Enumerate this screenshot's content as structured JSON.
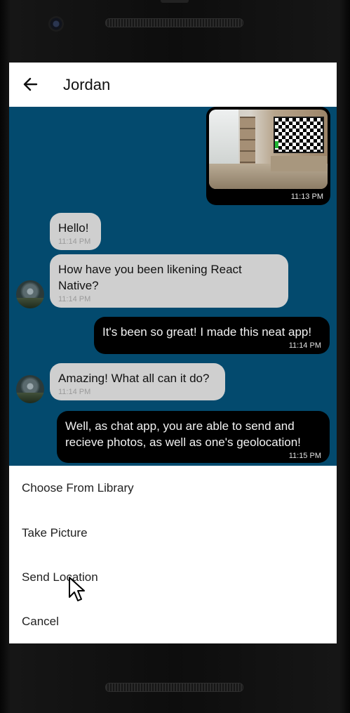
{
  "header": {
    "title": "Jordan"
  },
  "messages": [
    {
      "text": "Hello!",
      "time": "11:14 PM"
    },
    {
      "text": "How have you been likening React Native?",
      "time": "11:14 PM"
    },
    {
      "text": "It's been so great! I made this neat app!",
      "time": "11:14 PM"
    },
    {
      "text": "Amazing! What all can it do?",
      "time": "11:14 PM"
    },
    {
      "text": "Well, as chat app, you are able to send and recieve photos, as well as one's geolocation!",
      "time": "11:15 PM"
    }
  ],
  "photo_message": {
    "time": "11:13 PM"
  },
  "action_sheet": {
    "options": [
      "Choose From Library",
      "Take Picture",
      "Send Location",
      "Cancel"
    ]
  },
  "colors": {
    "chat_background": "#034a6e",
    "received_bubble": "#cfcfcf",
    "sent_bubble": "#000000",
    "tv_indicator": "#1fb533"
  }
}
